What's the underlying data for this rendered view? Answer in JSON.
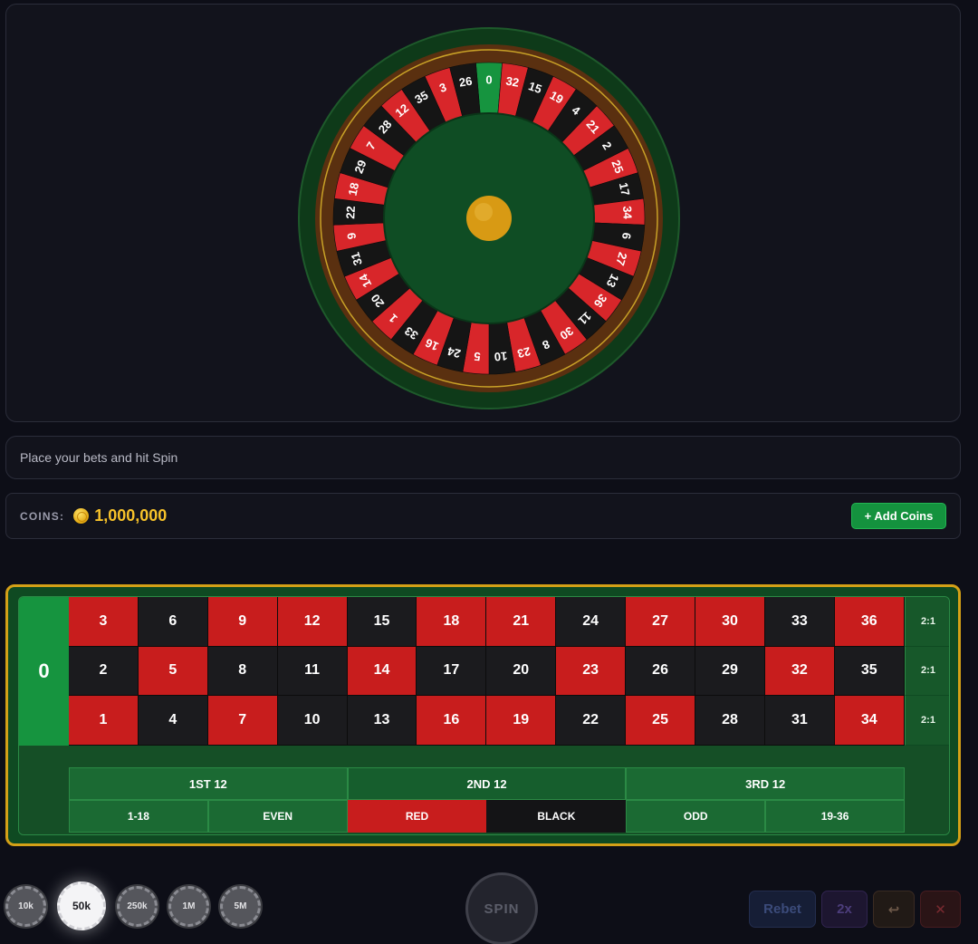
{
  "wheel": {
    "pockets": [
      "0",
      "32",
      "15",
      "19",
      "4",
      "21",
      "2",
      "25",
      "17",
      "34",
      "6",
      "27",
      "13",
      "36",
      "11",
      "30",
      "8",
      "23",
      "10",
      "5",
      "24",
      "16",
      "33",
      "1",
      "20",
      "14",
      "31",
      "9",
      "22",
      "18",
      "29",
      "7",
      "28",
      "12",
      "35",
      "3",
      "26"
    ],
    "colors": {
      "red": "#d8262a",
      "black": "#151515",
      "green": "#16943f",
      "felt": "#0f4d24",
      "rim": "#0e3a19",
      "ball": "#d89a14"
    }
  },
  "status": {
    "message": "Place your bets and hit Spin"
  },
  "coins": {
    "label": "COINS:",
    "value": "1,000,000",
    "add_label": "+ Add Coins"
  },
  "table": {
    "zero": "0",
    "rows": [
      [
        [
          "3",
          "red"
        ],
        [
          "6",
          "black"
        ],
        [
          "9",
          "red"
        ],
        [
          "12",
          "red"
        ],
        [
          "15",
          "black"
        ],
        [
          "18",
          "red"
        ],
        [
          "21",
          "red"
        ],
        [
          "24",
          "black"
        ],
        [
          "27",
          "red"
        ],
        [
          "30",
          "red"
        ],
        [
          "33",
          "black"
        ],
        [
          "36",
          "red"
        ]
      ],
      [
        [
          "2",
          "black"
        ],
        [
          "5",
          "red"
        ],
        [
          "8",
          "black"
        ],
        [
          "11",
          "black"
        ],
        [
          "14",
          "red"
        ],
        [
          "17",
          "black"
        ],
        [
          "20",
          "black"
        ],
        [
          "23",
          "red"
        ],
        [
          "26",
          "black"
        ],
        [
          "29",
          "black"
        ],
        [
          "32",
          "red"
        ],
        [
          "35",
          "black"
        ]
      ],
      [
        [
          "1",
          "red"
        ],
        [
          "4",
          "black"
        ],
        [
          "7",
          "red"
        ],
        [
          "10",
          "black"
        ],
        [
          "13",
          "black"
        ],
        [
          "16",
          "red"
        ],
        [
          "19",
          "red"
        ],
        [
          "22",
          "black"
        ],
        [
          "25",
          "red"
        ],
        [
          "28",
          "black"
        ],
        [
          "31",
          "black"
        ],
        [
          "34",
          "red"
        ]
      ]
    ],
    "column_bets": [
      "2:1",
      "2:1",
      "2:1"
    ],
    "dozens": [
      "1ST 12",
      "2ND 12",
      "3RD 12"
    ],
    "outsides": [
      {
        "label": "1-18",
        "color": "green"
      },
      {
        "label": "EVEN",
        "color": "green"
      },
      {
        "label": "RED",
        "color": "red"
      },
      {
        "label": "BLACK",
        "color": "black"
      },
      {
        "label": "ODD",
        "color": "green"
      },
      {
        "label": "19-36",
        "color": "green"
      }
    ]
  },
  "chips": [
    {
      "label": "10k",
      "selected": false
    },
    {
      "label": "50k",
      "selected": true
    },
    {
      "label": "250k",
      "selected": false
    },
    {
      "label": "1M",
      "selected": false
    },
    {
      "label": "5M",
      "selected": false
    }
  ],
  "actions": {
    "spin": "SPIN",
    "rebet": "Rebet",
    "double": "2x",
    "undo_icon": "undo-arrow-icon",
    "clear_icon": "close-x-icon"
  }
}
